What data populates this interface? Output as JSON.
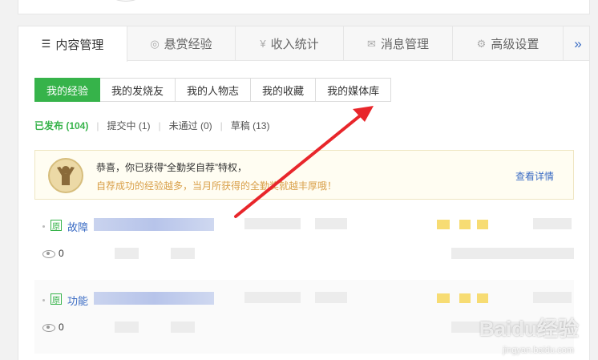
{
  "tabs": [
    {
      "label": "内容管理",
      "icon": "list-icon",
      "active": true
    },
    {
      "label": "悬赏经验",
      "icon": "coin-icon",
      "active": false
    },
    {
      "label": "收入统计",
      "icon": "yen-icon",
      "active": false
    },
    {
      "label": "消息管理",
      "icon": "mail-icon",
      "active": false
    },
    {
      "label": "高级设置",
      "icon": "gear-icon",
      "active": false
    }
  ],
  "tab_more": "»",
  "subtabs": [
    {
      "label": "我的经验",
      "active": true
    },
    {
      "label": "我的发烧友",
      "active": false
    },
    {
      "label": "我的人物志",
      "active": false
    },
    {
      "label": "我的收藏",
      "active": false
    },
    {
      "label": "我的媒体库",
      "active": false
    }
  ],
  "filters": [
    {
      "label": "已发布 (104)",
      "active": true
    },
    {
      "label": "提交中 (1)",
      "active": false
    },
    {
      "label": "未通过 (0)",
      "active": false
    },
    {
      "label": "草稿 (13)",
      "active": false
    }
  ],
  "notice": {
    "line1": "恭喜，你已获得“全勤奖自荐”特权，",
    "line2": "自荐成功的经验越多，当月所获得的全勤奖就越丰厚哦！",
    "link": "查看详情"
  },
  "items": [
    {
      "badge": "原",
      "title": "故障",
      "views": "0"
    },
    {
      "badge": "原",
      "title": "功能",
      "views": "0"
    }
  ],
  "watermark": {
    "logo": "Baidu经验",
    "url": "jingyan.baidu.com"
  },
  "colors": {
    "accent": "#36b34a",
    "link": "#3b6cc4",
    "arrow": "#e8262b"
  }
}
